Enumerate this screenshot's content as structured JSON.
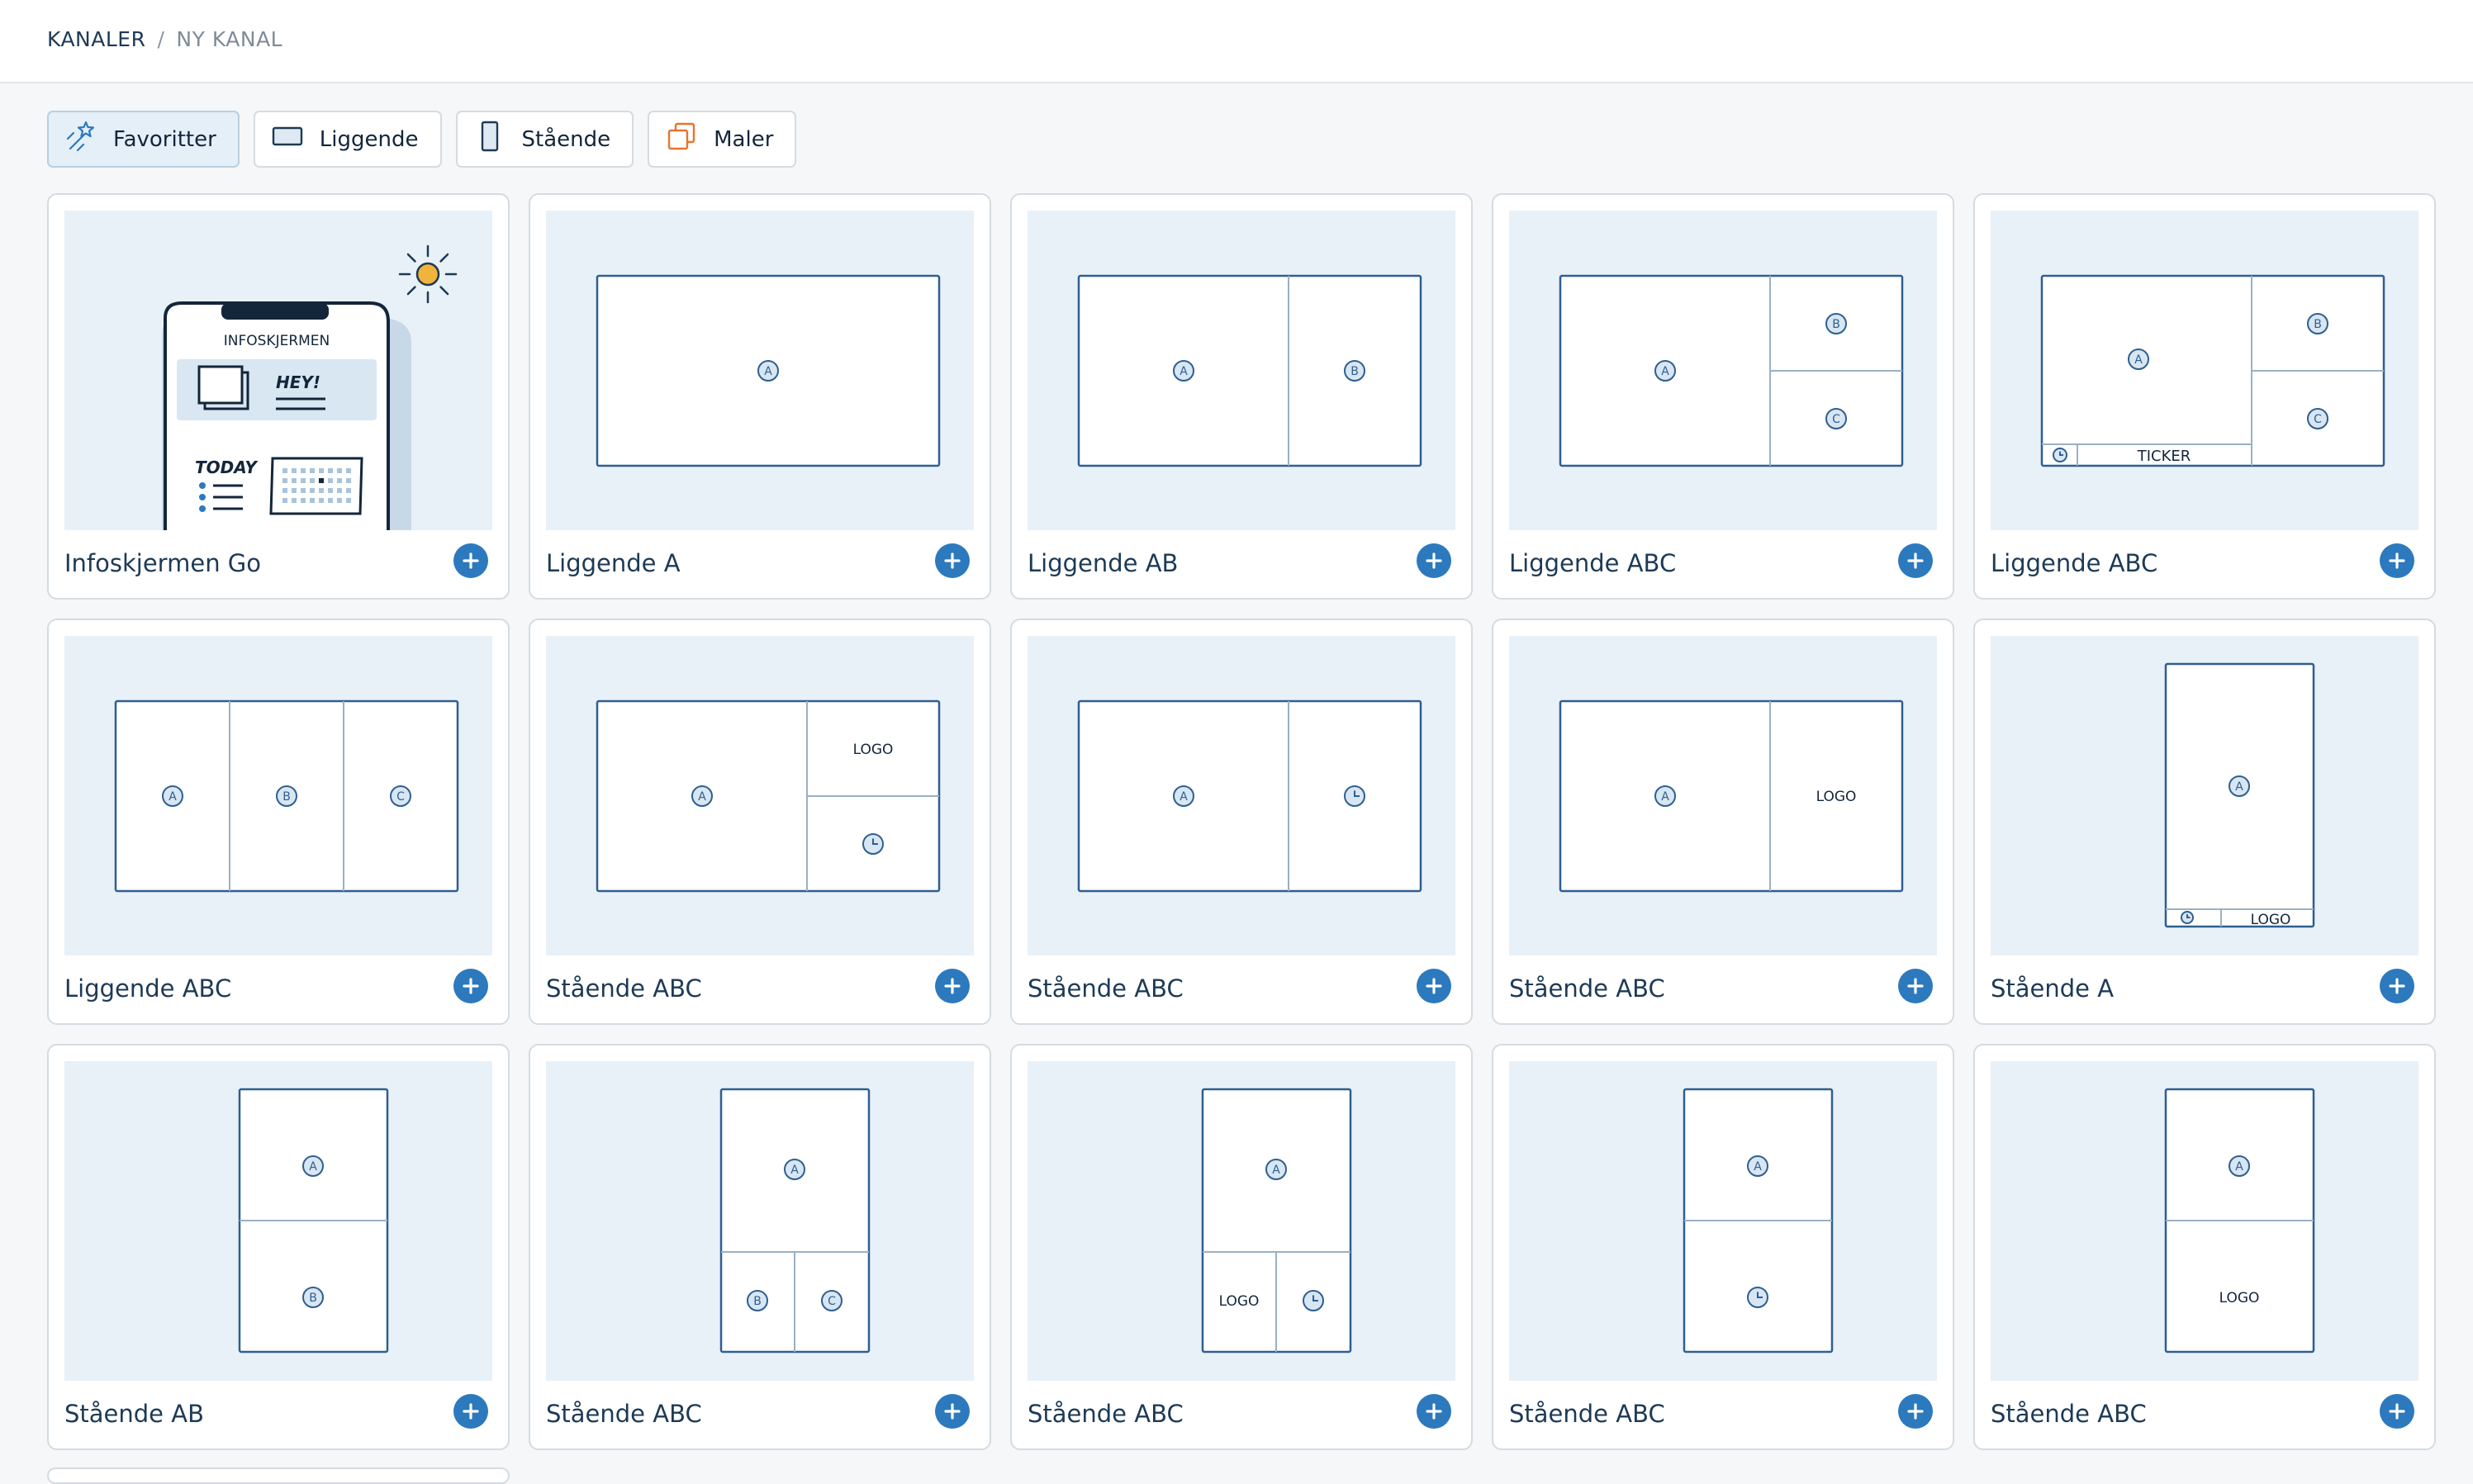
{
  "breadcrumb": {
    "root": "KANALER",
    "sep": "/",
    "current": "NY KANAL"
  },
  "tabs": [
    {
      "label": "Favoritter",
      "icon": "wand-stars-icon",
      "active": true
    },
    {
      "label": "Liggende",
      "icon": "landscape-screen-icon",
      "active": false
    },
    {
      "label": "Stående",
      "icon": "portrait-screen-icon",
      "active": false
    },
    {
      "label": "Maler",
      "icon": "templates-copy-icon",
      "active": false
    }
  ],
  "colors": {
    "accent": "#2c79be",
    "outline": "#2e5f91",
    "thumb_bg": "#e8f1f8",
    "sun": "#f0b43c",
    "orange": "#e8742a"
  },
  "cards": [
    {
      "label": "Infoskjermen Go",
      "layout": "infoskjermen-go",
      "phone_title": "INFOSKJERMEN",
      "bubble": "HEY!",
      "today": "TODAY"
    },
    {
      "label": "Liggende A",
      "layout": "L-A"
    },
    {
      "label": "Liggende AB",
      "layout": "L-AB"
    },
    {
      "label": "Liggende ABC",
      "layout": "L-A-BC"
    },
    {
      "label": "Liggende ABC",
      "layout": "L-A-BC-ticker",
      "ticker": "TICKER"
    },
    {
      "label": "Liggende ABC",
      "layout": "L-ABC-cols"
    },
    {
      "label": "Stående ABC",
      "layout": "L-A-logo-clock",
      "logo": "LOGO"
    },
    {
      "label": "Stående ABC",
      "layout": "L-A-clock"
    },
    {
      "label": "Stående ABC",
      "layout": "L-A-logo",
      "logo": "LOGO"
    },
    {
      "label": "Stående A",
      "layout": "P-A-footer",
      "logo": "LOGO"
    },
    {
      "label": "Stående AB",
      "layout": "P-AB"
    },
    {
      "label": "Stående ABC",
      "layout": "P-A-BC"
    },
    {
      "label": "Stående ABC",
      "layout": "P-A-logo-clock",
      "logo": "LOGO"
    },
    {
      "label": "Stående ABC",
      "layout": "P-A-clock"
    },
    {
      "label": "Stående ABC",
      "layout": "P-A-logo",
      "logo": "LOGO"
    }
  ]
}
